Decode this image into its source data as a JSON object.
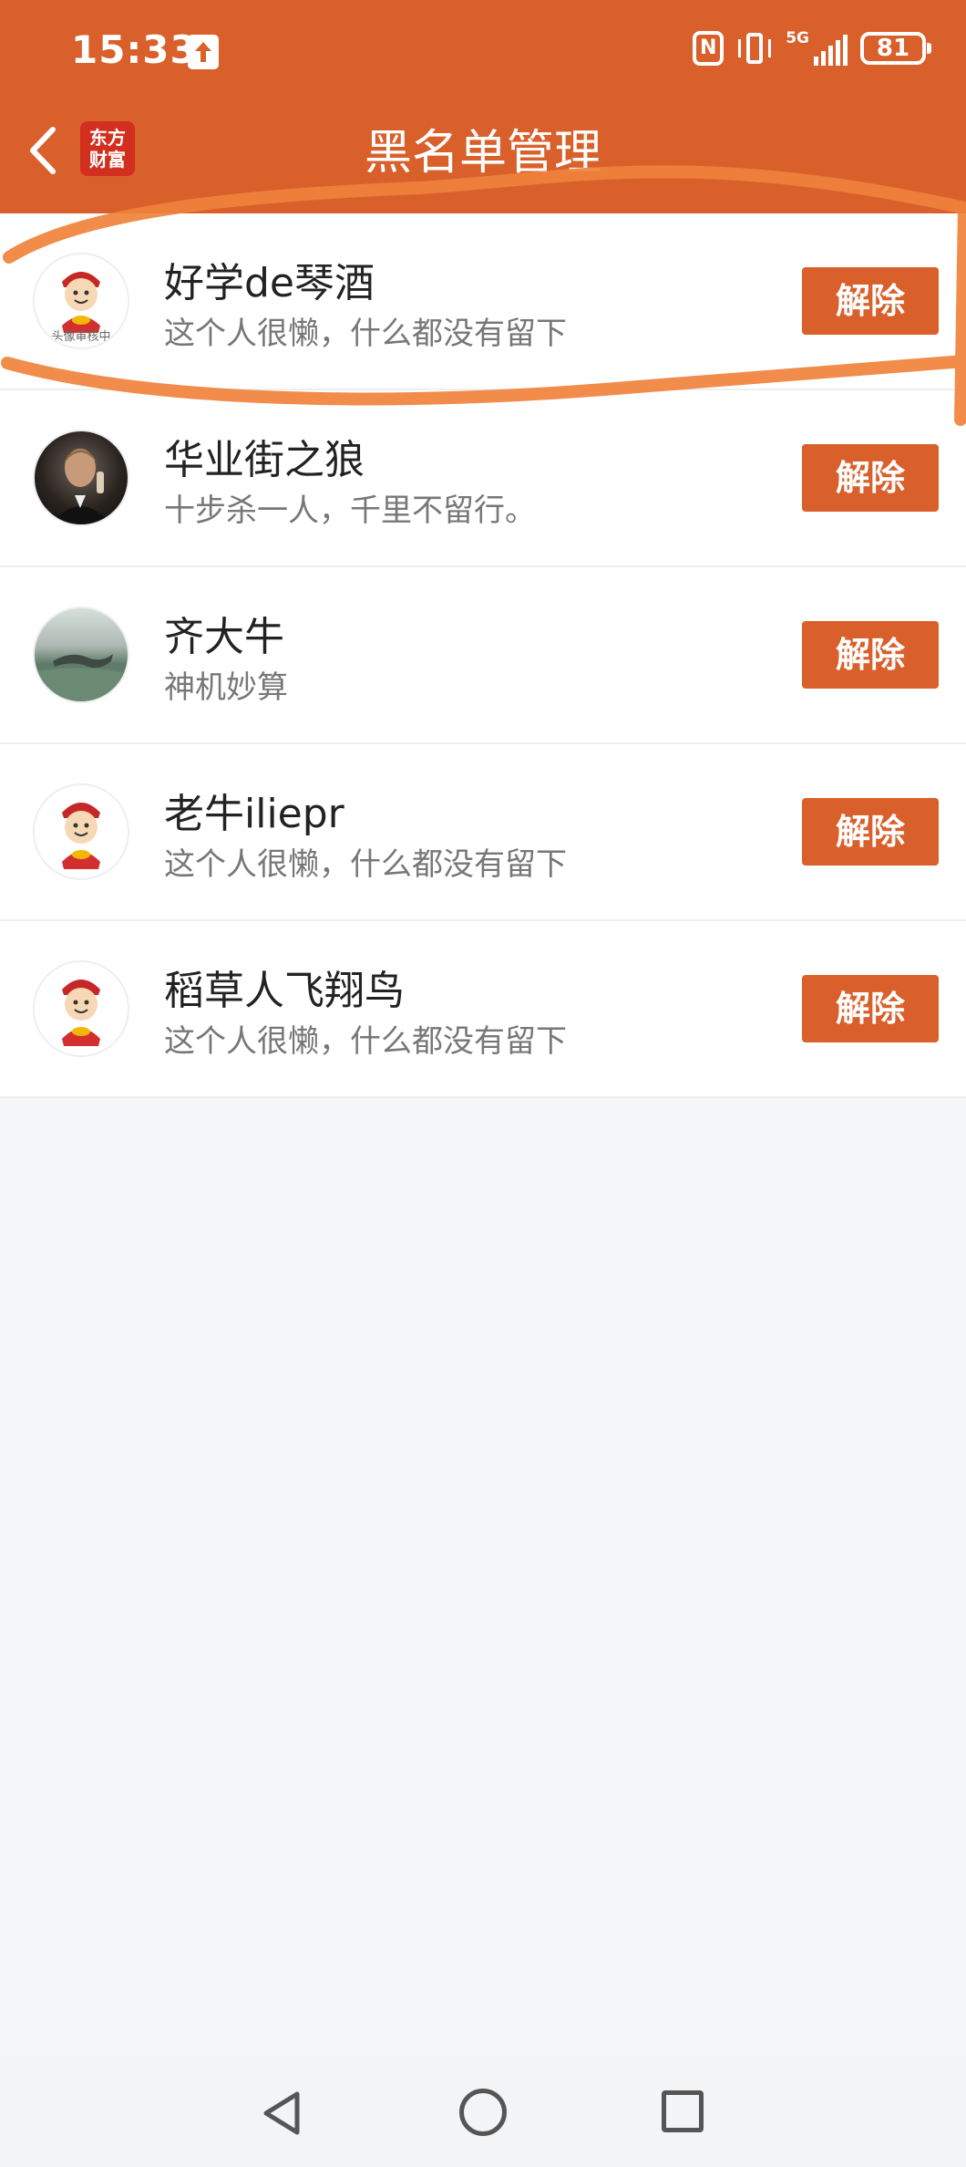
{
  "status_bar": {
    "time": "15:33",
    "network": "5G",
    "battery": "81"
  },
  "header": {
    "title": "黑名单管理",
    "logo_line1": "东方",
    "logo_line2": "财富"
  },
  "blocked_users": [
    {
      "name": "好学de琴酒",
      "bio": "这个人很懒，什么都没有留下",
      "avatar": "mascot",
      "avatar_caption": "头像审核中",
      "action": "解除"
    },
    {
      "name": "华业街之狼",
      "bio": "十步杀一人，千里不留行。",
      "avatar": "photo-dark",
      "action": "解除"
    },
    {
      "name": "齐大牛",
      "bio": "神机妙算",
      "avatar": "photo-landscape",
      "action": "解除"
    },
    {
      "name": "老牛iliepr",
      "bio": "这个人很懒，什么都没有留下",
      "avatar": "mascot",
      "action": "解除"
    },
    {
      "name": "稻草人飞翔鸟",
      "bio": "这个人很懒，什么都没有留下",
      "avatar": "mascot",
      "action": "解除"
    }
  ],
  "colors": {
    "accent": "#d9602b",
    "annotation": "#f0823c",
    "page_background": "#f6f7f9"
  },
  "icons": {
    "status": [
      "upload-icon",
      "nfc-icon",
      "vibrate-icon",
      "signal-icon",
      "battery-icon"
    ],
    "navigation": [
      "back-triangle-icon",
      "home-circle-icon",
      "recents-square-icon"
    ]
  }
}
